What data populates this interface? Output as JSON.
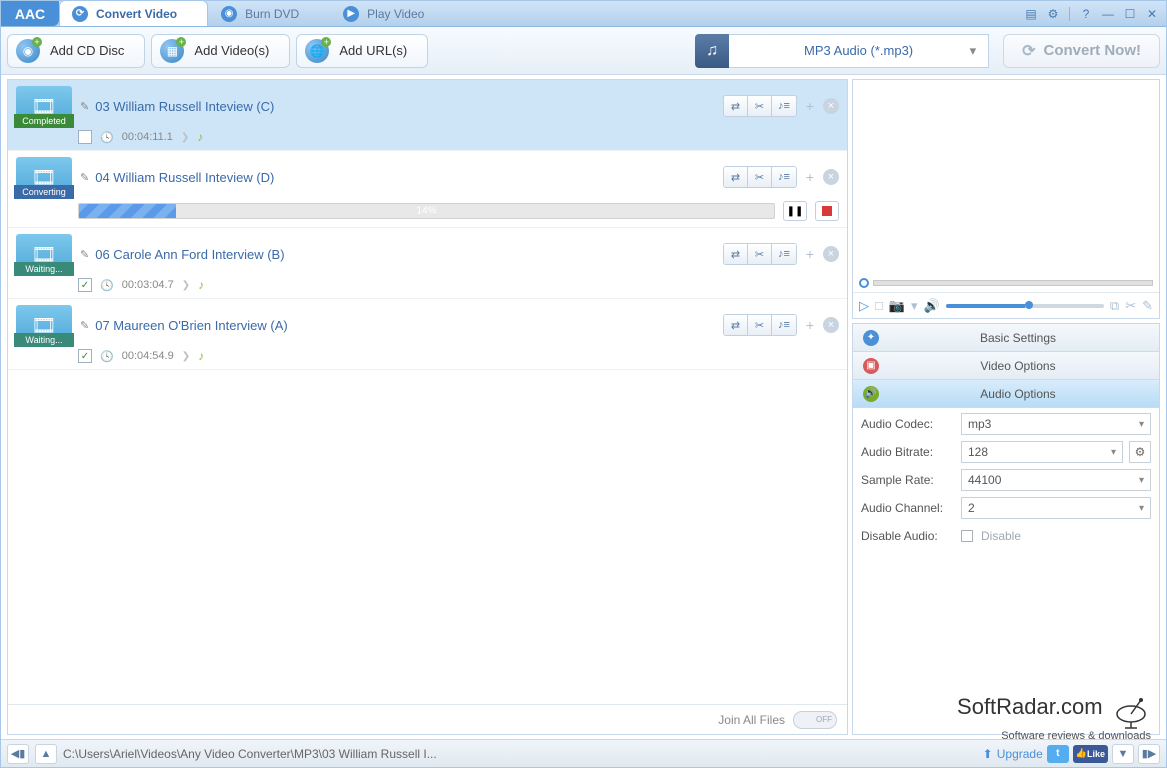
{
  "app_logo": "AAC",
  "tabs": [
    {
      "label": "Convert Video",
      "active": true,
      "icon": "refresh"
    },
    {
      "label": "Burn DVD",
      "active": false,
      "icon": "disc"
    },
    {
      "label": "Play Video",
      "active": false,
      "icon": "play"
    }
  ],
  "toolbar": {
    "add_cd": "Add CD Disc",
    "add_videos": "Add Video(s)",
    "add_urls": "Add URL(s)",
    "format_selected": "MP3 Audio (*.mp3)",
    "convert": "Convert Now!"
  },
  "files": [
    {
      "title": "03 William Russell Inteview (C)",
      "status": "Completed",
      "status_class": "completed",
      "duration": "00:04:11.1",
      "checked": false,
      "selected": true,
      "show_progress": false
    },
    {
      "title": "04 William Russell Inteview (D)",
      "status": "Converting",
      "status_class": "converting",
      "duration": "",
      "checked": false,
      "selected": false,
      "show_progress": true,
      "progress_pct": 14,
      "progress_label": "14%"
    },
    {
      "title": "06 Carole Ann Ford Interview (B)",
      "status": "Waiting...",
      "status_class": "waiting",
      "duration": "00:03:04.7",
      "checked": true,
      "selected": false,
      "show_progress": false
    },
    {
      "title": "07 Maureen O'Brien Interview (A)",
      "status": "Waiting...",
      "status_class": "waiting",
      "duration": "00:04:54.9",
      "checked": true,
      "selected": false,
      "show_progress": false
    }
  ],
  "list_footer": {
    "join_label": "Join All Files",
    "toggle_state": "OFF"
  },
  "accordions": {
    "basic": "Basic Settings",
    "video": "Video Options",
    "audio": "Audio Options"
  },
  "audio_options": {
    "codec_label": "Audio Codec:",
    "codec_value": "mp3",
    "bitrate_label": "Audio Bitrate:",
    "bitrate_value": "128",
    "sample_label": "Sample Rate:",
    "sample_value": "44100",
    "channel_label": "Audio Channel:",
    "channel_value": "2",
    "disable_label": "Disable Audio:",
    "disable_text": "Disable"
  },
  "statusbar": {
    "path": "C:\\Users\\Ariel\\Videos\\Any Video Converter\\MP3\\03 William Russell I...",
    "upgrade": "Upgrade",
    "fb": "Like"
  },
  "watermark": {
    "title": "SoftRadar.com",
    "sub": "Software reviews & downloads"
  }
}
